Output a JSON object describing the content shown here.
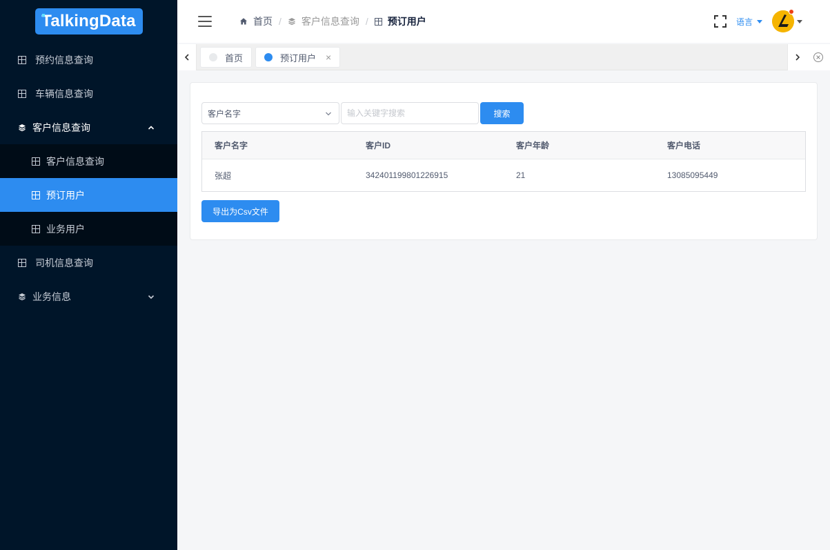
{
  "brand": {
    "logo_text": "TalkingData"
  },
  "sidebar": {
    "items": [
      {
        "label": "预约信息查询"
      },
      {
        "label": "车辆信息查询"
      },
      {
        "label": "客户信息查询",
        "children": [
          {
            "label": "客户信息查询"
          },
          {
            "label": "预订用户"
          },
          {
            "label": "业务用户"
          }
        ]
      },
      {
        "label": "司机信息查询"
      },
      {
        "label": "业务信息"
      }
    ]
  },
  "header": {
    "breadcrumb": [
      "首页",
      "客户信息查询",
      "预订用户"
    ],
    "lang_label": "语言"
  },
  "tags": [
    {
      "label": "首页"
    },
    {
      "label": "预订用户",
      "close": "×"
    }
  ],
  "search": {
    "select_value": "客户名字",
    "placeholder": "输入关键字搜索",
    "button": "搜索"
  },
  "table": {
    "columns": [
      "客户名字",
      "客户ID",
      "客户年龄",
      "客户电话"
    ],
    "rows": [
      [
        "张超",
        "342401199801226915",
        "21",
        "13085095449"
      ]
    ]
  },
  "export_button": "导出为Csv文件",
  "colors": {
    "sidebar_bg": "#001529",
    "accent": "#2d8cf0",
    "badge": "#ed4014"
  }
}
